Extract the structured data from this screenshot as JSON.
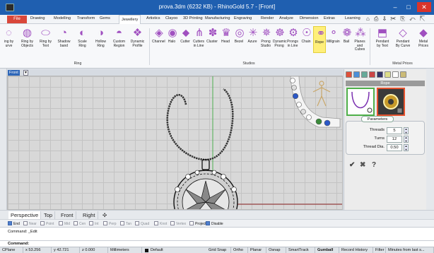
{
  "window": {
    "title": "prova.3dm (6232 KB) - RhinoGold 5.7 - [Front]",
    "minimize": "–",
    "maximize": "□",
    "close": "✕"
  },
  "menu": {
    "file": "File",
    "items": [
      "Drawing",
      "Modelling",
      "Transform",
      "Gems",
      "Jewellery",
      "Artistics",
      "Clayoo",
      "3D Printing",
      "Manufacturing",
      "Engraving",
      "Render",
      "Analyze",
      "Dimension",
      "Extras",
      "Learning"
    ],
    "active": "Jewellery"
  },
  "ribbon": {
    "ring_tools": [
      {
        "label": "ing by\nurve"
      },
      {
        "label": "Ring by\nObjects"
      },
      {
        "label": "Ring by\nText"
      },
      {
        "label": "Shadow\nband"
      },
      {
        "label": "Scale\nRing"
      },
      {
        "label": "Hollow\nRing"
      },
      {
        "label": "Custom\nRegion"
      },
      {
        "label": "Dynamic\nProfile"
      }
    ],
    "studio_tools": [
      {
        "label": "Channel"
      },
      {
        "label": "Halo"
      },
      {
        "label": "Cutter"
      },
      {
        "label": "Cutters\nin Line"
      },
      {
        "label": "Cluster"
      },
      {
        "label": "Head"
      },
      {
        "label": "Bezel"
      },
      {
        "label": "Azure"
      },
      {
        "label": "Prong\nStudio"
      },
      {
        "label": "Dynamic\nProng"
      },
      {
        "label": "Prongs\nin Line"
      },
      {
        "label": "Chain"
      },
      {
        "label": "Rope"
      },
      {
        "label": "Millgrain"
      },
      {
        "label": "Bail"
      },
      {
        "label": "Planes and\nCubes"
      }
    ],
    "price_tools": [
      {
        "label": "Pendant\nby Text"
      },
      {
        "label": "Pendant\nBy Curve"
      },
      {
        "label": "Metal\nPrices"
      }
    ],
    "groups": {
      "ring": "Ring",
      "studios": "Studios",
      "metal_prices": "Metal Prices"
    },
    "highlight": "Rope"
  },
  "viewport": {
    "label": "Front",
    "arrow": "▼"
  },
  "panel": {
    "header": "Rope",
    "parameters_title": "Parameters",
    "params": [
      {
        "label": "Threads",
        "value": "5"
      },
      {
        "label": "Turns",
        "value": "12"
      },
      {
        "label": "Thread Dia.",
        "value": "0.50"
      }
    ],
    "actions": {
      "ok": "✔",
      "cancel": "✖",
      "help": "?"
    }
  },
  "viewtabs": {
    "tabs": [
      "Perspective",
      "Top",
      "Front",
      "Right"
    ],
    "active": "Perspective",
    "add": "✣"
  },
  "osnaps": {
    "items": [
      {
        "label": "End",
        "checked": true
      },
      {
        "label": "Near",
        "checked": false
      },
      {
        "label": "Point",
        "checked": false
      },
      {
        "label": "Mid",
        "checked": false
      },
      {
        "label": "Cen",
        "checked": false
      },
      {
        "label": "Int",
        "checked": false
      },
      {
        "label": "Perp",
        "checked": false
      },
      {
        "label": "Tan",
        "checked": false
      },
      {
        "label": "Quad",
        "checked": false
      },
      {
        "label": "Knot",
        "checked": false
      },
      {
        "label": "Vertex",
        "checked": false
      },
      {
        "label": "Project",
        "checked": false
      },
      {
        "label": "Disable",
        "checked": true
      }
    ]
  },
  "command": {
    "history": "Command: _Edit",
    "prompt": "Command:"
  },
  "status": {
    "cplane": "CPlane",
    "x": "x 53.256",
    "y": "y 42.721",
    "z": "z 0.000",
    "units": "Millimeters",
    "layer": "Default",
    "toggles": [
      "Grid Snap",
      "Ortho",
      "Planar",
      "Osnap",
      "SmartTrack",
      "Gumball",
      "Record History",
      "Filter",
      "Minutes from last s..."
    ],
    "active_toggle": "Gumball"
  }
}
